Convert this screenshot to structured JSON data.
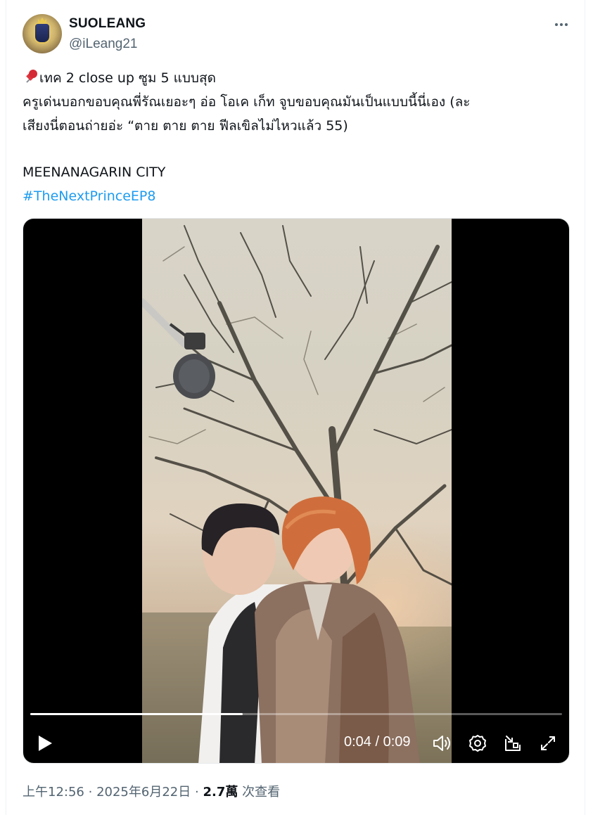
{
  "author": {
    "display_name": "SUOLEANG",
    "handle": "@iLeang21"
  },
  "tweet": {
    "line1": "เทค 2 close up ซูม 5 แบบสุด",
    "line2": "ครูเด่นบอกขอบคุณพี่รัณเยอะๆ อ่อ โอเค เก็ท จูบขอบคุณมันเป็นแบบนี้นี่เอง (ละ",
    "line3": "เสียงนี่ตอนถ่ายอ่ะ “ตาย ตาย ตาย ฟีลเขิลไม่ไหวแล้ว 55)",
    "line4": "MEENANAGARIN CITY",
    "hashtag": "#TheNextPrinceEP8"
  },
  "video": {
    "progress": 0.4,
    "time": "0:04 / 0:09"
  },
  "footer": {
    "time": "上午12:56",
    "sep1": "·",
    "date": "2025年6月22日",
    "sep2": "·",
    "views_count": "2.7萬",
    "views_label": "次查看"
  },
  "icons": {
    "pin": "pushpin-icon",
    "more": "more-icon",
    "play": "play-icon",
    "volume": "volume-icon",
    "settings": "settings-icon",
    "pip": "picture-in-picture-icon",
    "fullscreen": "fullscreen-icon"
  },
  "colors": {
    "link": "#1d9bf0",
    "secondary_text": "#536471",
    "primary_text": "#0f1419"
  }
}
